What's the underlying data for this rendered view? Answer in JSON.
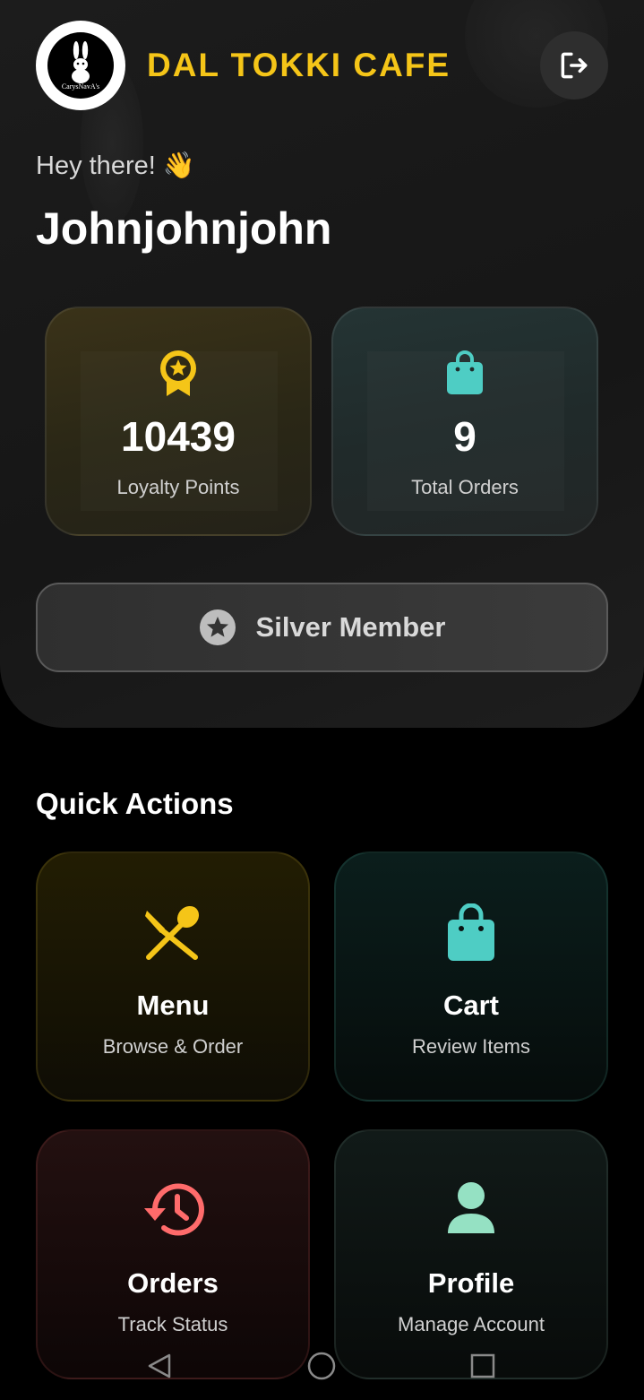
{
  "app": {
    "brand": "DAL TOKKI CAFE",
    "logo_text": "CarysNavA's"
  },
  "header": {
    "greeting": "Hey there! 👋",
    "username": "Johnjohnjohn",
    "logout_icon": "logout-icon"
  },
  "stats": {
    "points_value": "10439",
    "points_label": "Loyalty Points",
    "orders_value": "9",
    "orders_label": "Total Orders"
  },
  "membership": {
    "label": "Silver Member"
  },
  "quick_actions": {
    "title": "Quick Actions",
    "items": [
      {
        "title": "Menu",
        "subtitle": "Browse & Order",
        "icon": "utensils-icon",
        "color": "#F5C518"
      },
      {
        "title": "Cart",
        "subtitle": "Review Items",
        "icon": "shopping-bag-icon",
        "color": "#4ECDC4"
      },
      {
        "title": "Orders",
        "subtitle": "Track Status",
        "icon": "history-icon",
        "color": "#FF6B6B"
      },
      {
        "title": "Profile",
        "subtitle": "Manage Account",
        "icon": "person-icon",
        "color": "#95E1C3"
      }
    ]
  },
  "colors": {
    "accent": "#F5C518",
    "teal": "#4ECDC4",
    "red": "#FF6B6B",
    "mint": "#95E1C3"
  }
}
